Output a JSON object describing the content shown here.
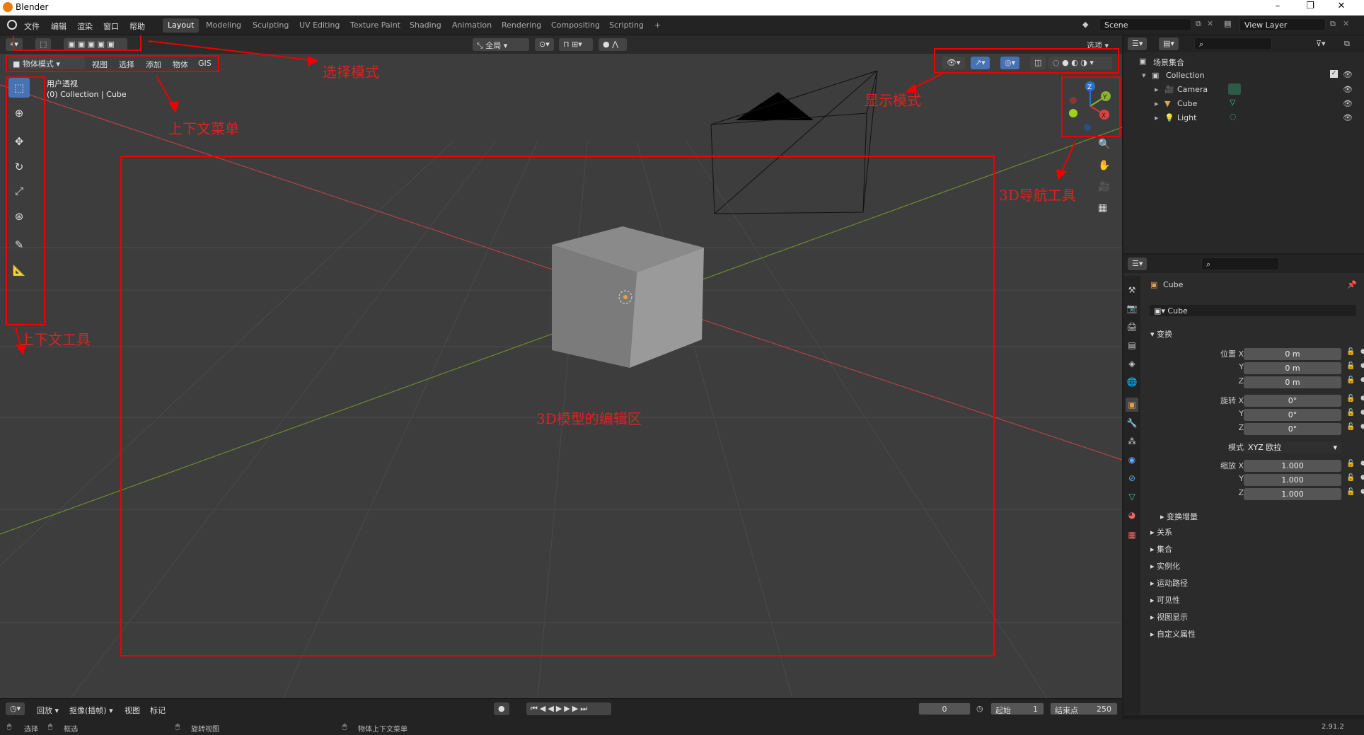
{
  "window": {
    "title": "Blender",
    "buttons": [
      "–",
      "❐",
      "✕"
    ]
  },
  "menu": [
    "文件",
    "编辑",
    "渲染",
    "窗口",
    "帮助"
  ],
  "workspaces": [
    "Layout",
    "Modeling",
    "Sculpting",
    "UV Editing",
    "Texture Paint",
    "Shading",
    "Animation",
    "Rendering",
    "Compositing",
    "Scripting",
    "+"
  ],
  "scene": "Scene",
  "view_layer": "View Layer",
  "viewport": {
    "mode": "物体模式",
    "menus": [
      "视图",
      "选择",
      "添加",
      "物体",
      "GIS"
    ],
    "orientation": "全局",
    "options": "选项",
    "overlay_title": "用户透视",
    "overlay_sub": "(0) Collection | Cube"
  },
  "annotations": {
    "select_mode": "选择模式",
    "context_menu": "上下文菜单",
    "display_mode": "显示模式",
    "nav_tools": "3D导航工具",
    "context_tools": "上下文工具",
    "edit_area": "3D模型的编辑区"
  },
  "gizmo": {
    "z": "Z",
    "y": "Y",
    "x": "X"
  },
  "outliner": {
    "root": "场景集合",
    "collection": "Collection",
    "items": [
      "Camera",
      "Cube",
      "Light"
    ]
  },
  "properties": {
    "object_name": "Cube",
    "data_name": "Cube",
    "section": "变换",
    "location": {
      "label": "位置 X",
      "x": "0 m",
      "y": "0 m",
      "z": "0 m"
    },
    "rotation": {
      "label": "旋转 X",
      "x": "0°",
      "y": "0°",
      "z": "0°"
    },
    "mode_label": "模式",
    "mode": "XYZ 欧拉",
    "scale": {
      "label": "缩放 X",
      "x": "1.000",
      "y": "1.000",
      "z": "1.000"
    },
    "axis_y": "Y",
    "axis_z": "Z",
    "delta": "变换增量",
    "sections": [
      "关系",
      "集合",
      "实例化",
      "运动路径",
      "可见性",
      "视图显示",
      "自定义属性"
    ]
  },
  "timeline": {
    "menus": [
      "回放",
      "抠像(插帧)",
      "视图",
      "标记"
    ],
    "frame": "0",
    "start_label": "起始",
    "start": "1",
    "end_label": "结束点",
    "end": "250"
  },
  "status": {
    "select": "选择",
    "box": "框选",
    "rotate": "旋转视图",
    "context": "物体上下文菜单",
    "version": "2.91.2"
  }
}
